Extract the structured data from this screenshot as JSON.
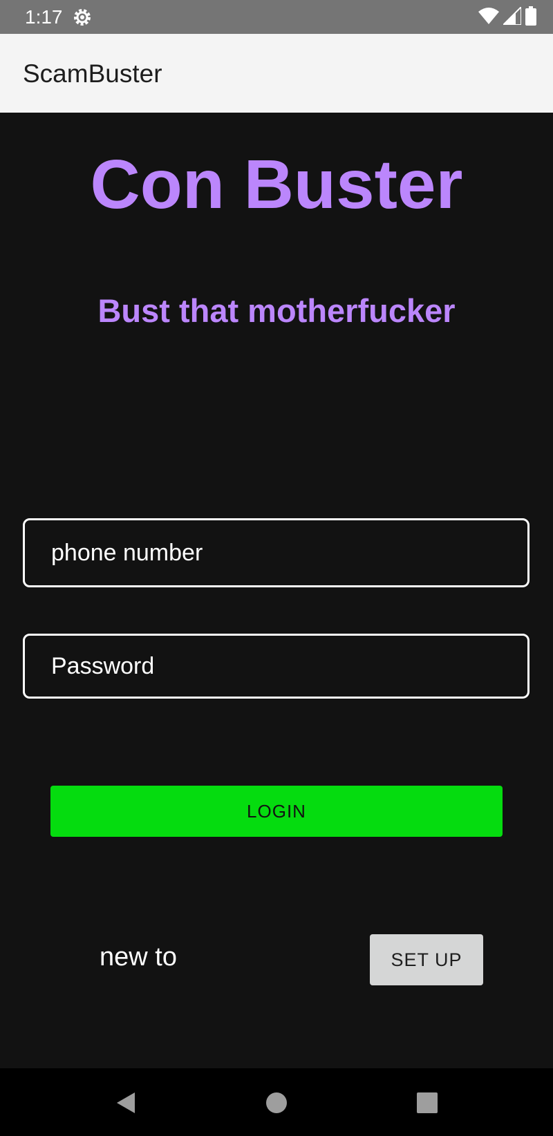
{
  "status_bar": {
    "time": "1:17",
    "icons": [
      "settings-gear-icon",
      "wifi-icon",
      "cellular-signal-icon",
      "battery-icon"
    ]
  },
  "app_bar": {
    "title": "ScamBuster"
  },
  "main": {
    "title": "Con Buster",
    "subtitle": "Bust that motherfucker",
    "phone_placeholder": "phone number",
    "password_placeholder": "Password",
    "login_label": "LOGIN",
    "new_to_label": "new to",
    "setup_label": "SET UP"
  },
  "nav_bar": {
    "icons": [
      "back-icon",
      "home-icon",
      "recents-icon"
    ]
  },
  "colors": {
    "background": "#121212",
    "accent": "#bb86fc",
    "login_button": "#05dc0f",
    "setup_button": "#d5d6d6",
    "status_bar": "#757575",
    "app_bar": "#f4f4f4"
  }
}
